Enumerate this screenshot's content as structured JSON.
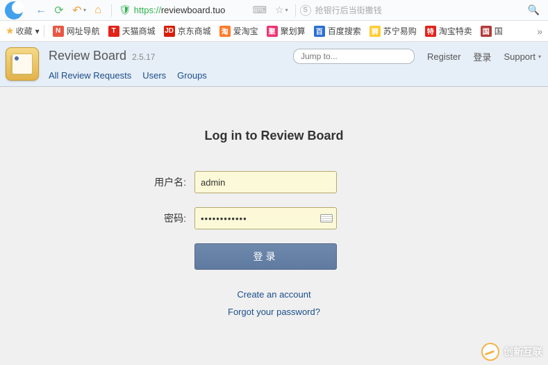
{
  "browser": {
    "url_proto": "https://",
    "url_rest": "reviewboard.tuo",
    "search_placeholder": "抢银行后当街撒钱"
  },
  "bookmarks": {
    "fav_label": "收藏",
    "items": [
      {
        "label": "网址导航",
        "bg": "#e85744",
        "ico": "N"
      },
      {
        "label": "天猫商城",
        "bg": "#e2231a",
        "ico": "T"
      },
      {
        "label": "京东商城",
        "bg": "#d81e06",
        "ico": "JD"
      },
      {
        "label": "爱淘宝",
        "bg": "#ff7a29",
        "ico": "淘"
      },
      {
        "label": "聚划算",
        "bg": "#ef3473",
        "ico": "聚"
      },
      {
        "label": "百度搜索",
        "bg": "#2b6fd4",
        "ico": "百"
      },
      {
        "label": "苏宁易购",
        "bg": "#ffcc33",
        "ico": "狮"
      },
      {
        "label": "淘宝特卖",
        "bg": "#e2231a",
        "ico": "特"
      },
      {
        "label": "国",
        "bg": "#b23b3b",
        "ico": "国"
      }
    ]
  },
  "app": {
    "title": "Review Board",
    "version": "2.5.17",
    "nav": {
      "all_requests": "All Review Requests",
      "users": "Users",
      "groups": "Groups"
    },
    "jump_placeholder": "Jump to...",
    "register": "Register",
    "login_link": "登录",
    "support": "Support"
  },
  "login": {
    "heading": "Log in to Review Board",
    "username_label": "用户名:",
    "username_value": "admin",
    "password_label": "密码:",
    "password_value": "••••••••••••",
    "submit": "登录",
    "create_account": "Create an account",
    "forgot": "Forgot your password?"
  },
  "watermark": "创新互联"
}
